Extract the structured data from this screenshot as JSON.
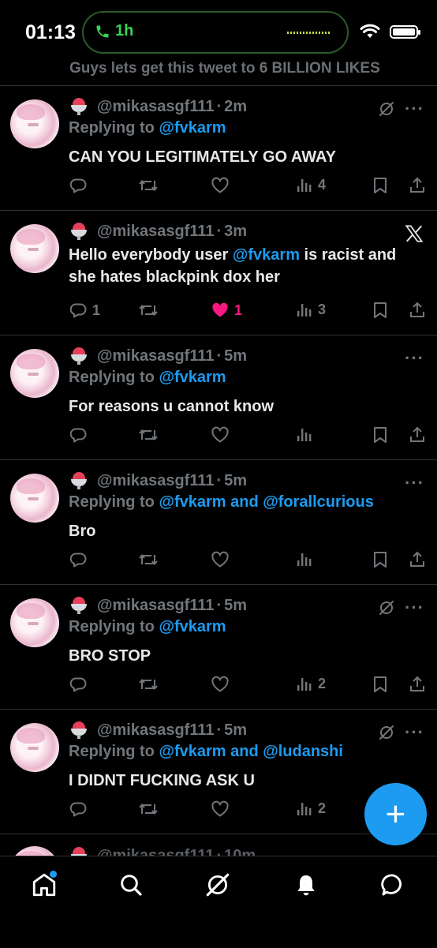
{
  "status_bar": {
    "time": "01:13",
    "call_duration": "1h"
  },
  "top_partial_text": "Guys lets get this tweet to 6 BILLION LIKES",
  "tweets": [
    {
      "handle": "@mikasasgf111",
      "sep": "·",
      "time": "2m",
      "reply_prefix": "Replying to ",
      "reply_to": "@fvkarm",
      "reply_extra_link": "",
      "text": "CAN YOU LEGITIMATELY GO AWAY",
      "replies": "",
      "retweets": "",
      "likes": "",
      "views": "4"
    },
    {
      "handle": "@mikasasgf111",
      "sep": "·",
      "time": "3m",
      "text_pre": "Hello everybody user ",
      "text_link": "@fvkarm",
      "text_post": " is racist and she hates blackpink dox her",
      "replies": "1",
      "retweets": "",
      "likes": "1",
      "views": "3"
    },
    {
      "handle": "@mikasasgf111",
      "sep": "·",
      "time": "5m",
      "reply_prefix": "Replying to ",
      "reply_to": "@fvkarm",
      "reply_extra_link": "",
      "text": "For reasons u cannot know",
      "replies": "",
      "retweets": "",
      "likes": "",
      "views": ""
    },
    {
      "handle": "@mikasasgf111",
      "sep": "·",
      "time": "5m",
      "reply_prefix": "Replying to ",
      "reply_to": "@fvkarm and @forallcurious",
      "reply_extra_link": "",
      "text": "Bro",
      "replies": "",
      "retweets": "",
      "likes": "",
      "views": ""
    },
    {
      "handle": "@mikasasgf111",
      "sep": "·",
      "time": "5m",
      "reply_prefix": "Replying to ",
      "reply_to": "@fvkarm",
      "reply_extra_link": "",
      "text": "BRO STOP",
      "replies": "",
      "retweets": "",
      "likes": "",
      "views": "2"
    },
    {
      "handle": "@mikasasgf111",
      "sep": "·",
      "time": "5m",
      "reply_prefix": "Replying to ",
      "reply_to": "@fvkarm and @ludanshi",
      "reply_extra_link": "",
      "text": "I DIDNT FUCKING ASK U",
      "replies": "",
      "retweets": "",
      "likes": "",
      "views": "2"
    }
  ],
  "bottom_partial": {
    "handle": "@mikasasgf111",
    "sep": "·",
    "time": "10m"
  },
  "fab_label": "+",
  "icons": {
    "tabs": [
      "home-icon",
      "search-icon",
      "grok-icon",
      "notifications-icon",
      "messages-icon"
    ],
    "actions": [
      "reply-icon",
      "retweet-icon",
      "like-icon",
      "views-icon",
      "bookmark-icon",
      "share-icon"
    ]
  },
  "colors": {
    "accent": "#1d9bf0",
    "like": "#f91880",
    "muted": "#71767b",
    "call_green": "#39d353"
  }
}
